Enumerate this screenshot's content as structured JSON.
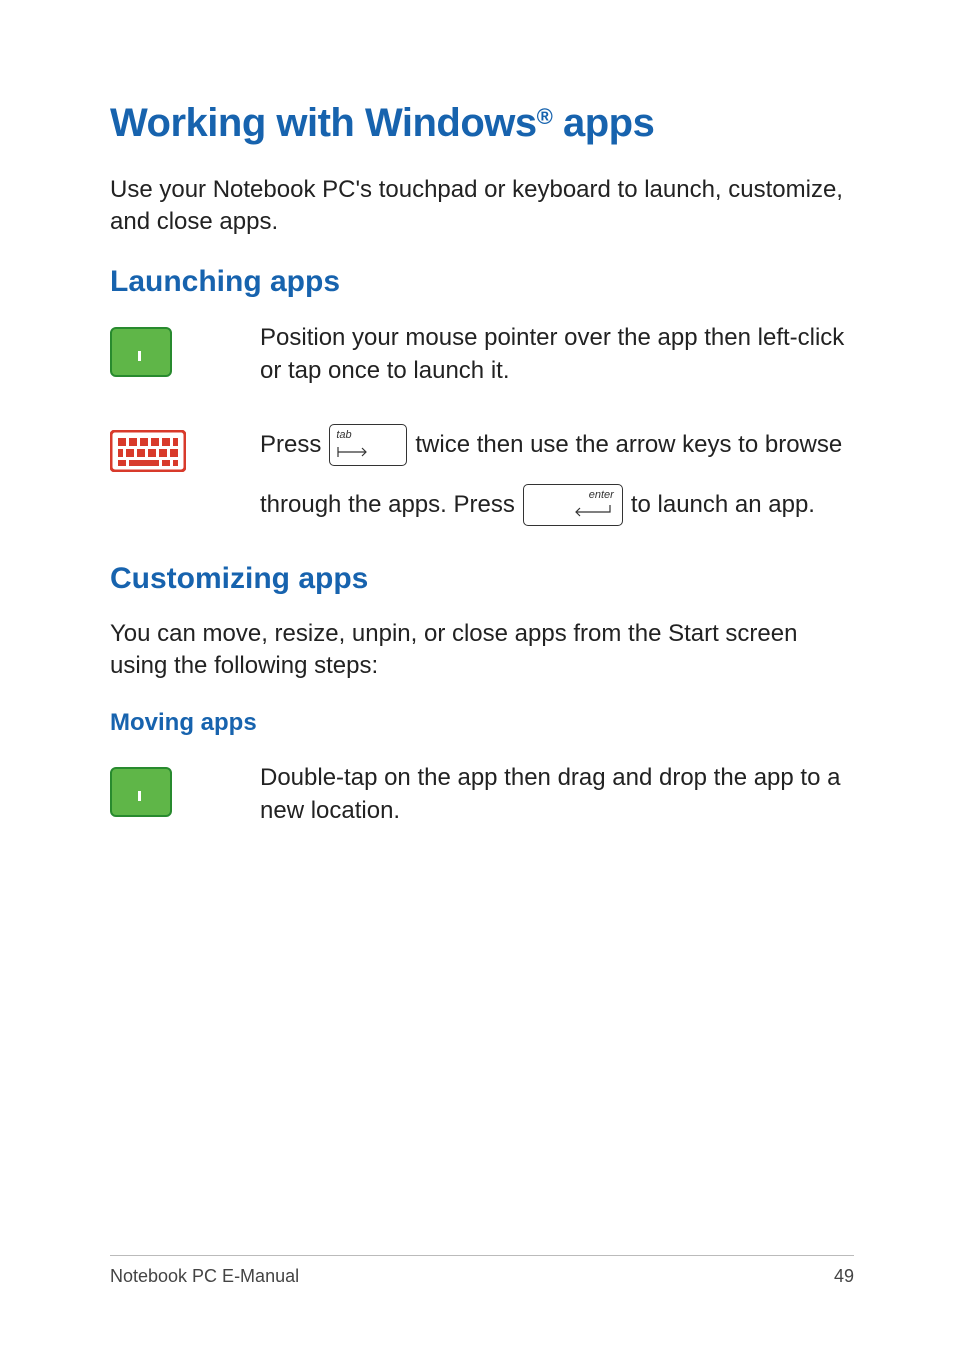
{
  "h1_pre": "Working with Windows",
  "h1_reg": "®",
  "h1_post": " apps",
  "intro": "Use your Notebook PC's touchpad or keyboard to launch, customize, and close apps.",
  "h2_launching": "Launching apps",
  "launch_touchpad": "Position your mouse pointer over the app then left-click or tap once to launch it.",
  "kb_press": "Press ",
  "kb_twice": " twice then use the arrow keys to browse",
  "kb_line2a": "through the apps. Press ",
  "kb_line2b": " to launch an app.",
  "tab_label": "tab",
  "enter_label": "enter",
  "h2_custom": "Customizing apps",
  "custom_intro": "You can move, resize, unpin, or close apps from the Start screen using the following steps:",
  "h3_moving": "Moving apps",
  "moving_text": "Double-tap on the app then drag and drop the app to a new location.",
  "footer_left": "Notebook PC E-Manual",
  "footer_right": "49"
}
